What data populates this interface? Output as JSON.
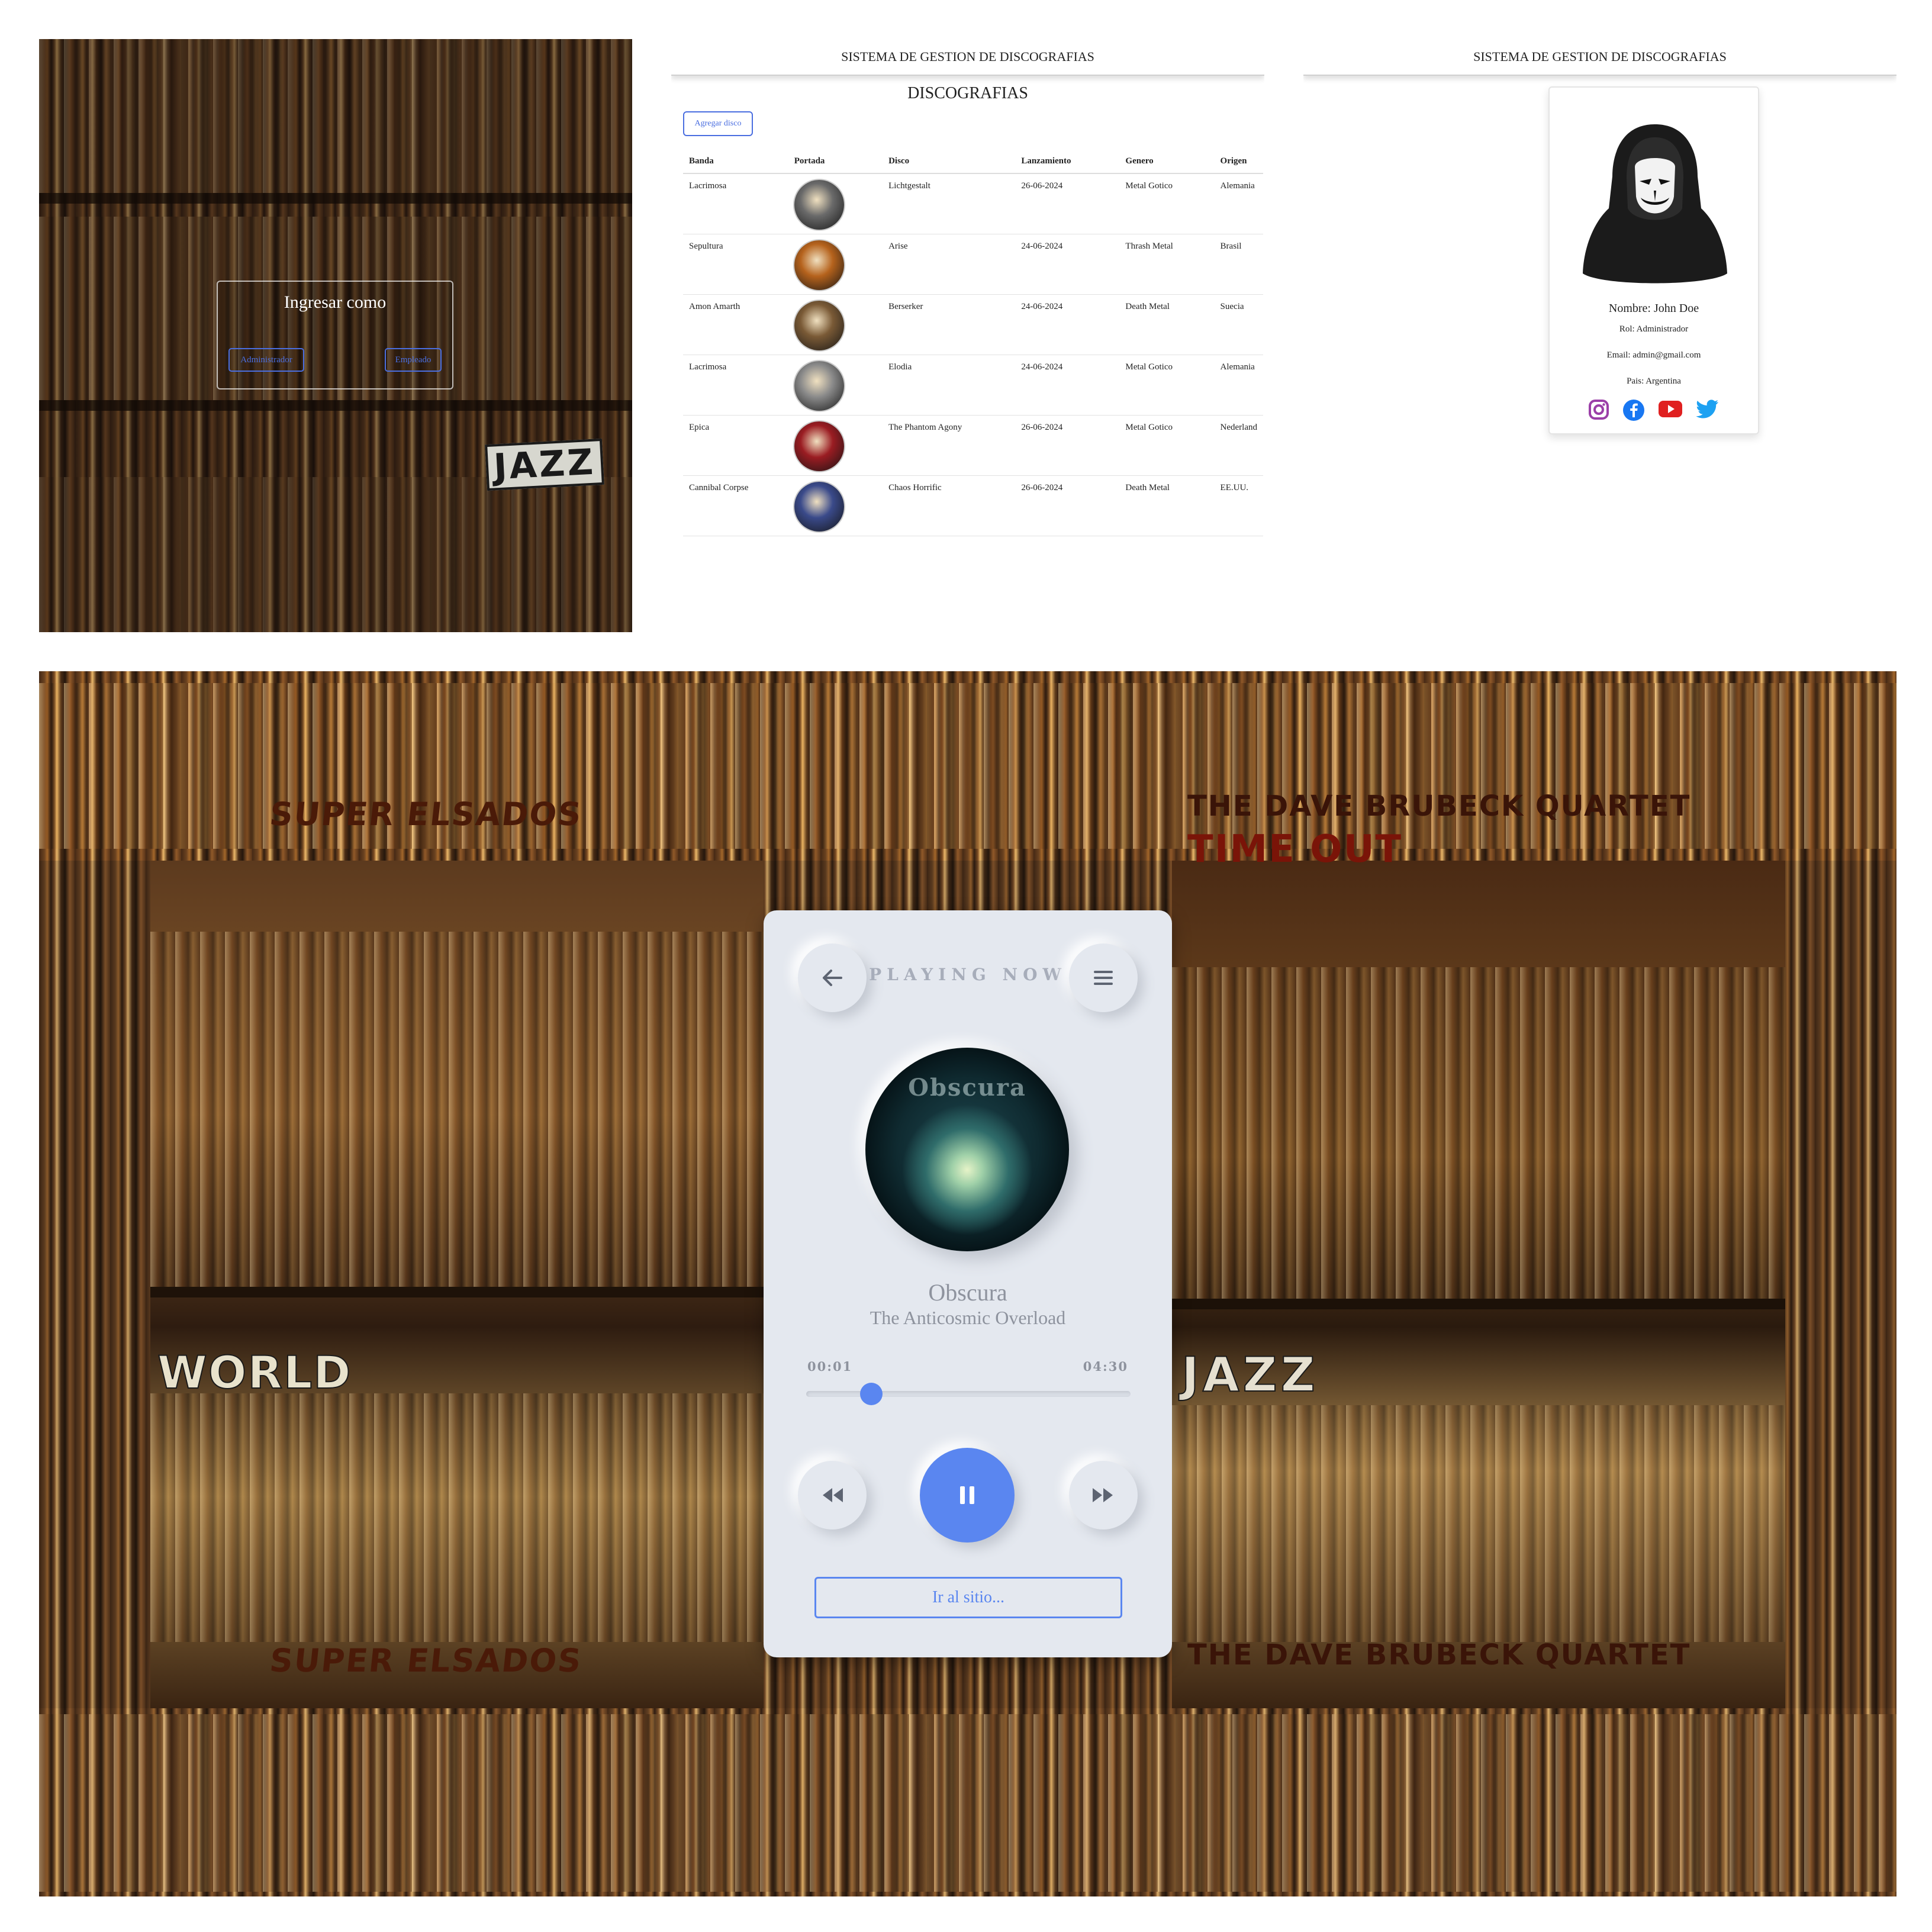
{
  "login": {
    "title": "Ingresar como",
    "admin_button": "Administrador",
    "employee_button": "Empleado"
  },
  "header": {
    "site_title": "SISTEMA DE GESTION DE DISCOGRAFIAS"
  },
  "discography": {
    "title": "DISCOGRAFIAS",
    "add_button": "Agregar disco",
    "columns": [
      "Banda",
      "Portada",
      "Disco",
      "Lanzamiento",
      "Genero",
      "Origen"
    ],
    "rows": [
      {
        "band": "Lacrimosa",
        "album": "Lichtgestalt",
        "release": "26-06-2024",
        "genre": "Metal Gotico",
        "origin": "Alemania",
        "cover_color": "#6a6a6a"
      },
      {
        "band": "Sepultura",
        "album": "Arise",
        "release": "24-06-2024",
        "genre": "Thrash Metal",
        "origin": "Brasil",
        "cover_color": "#b5621c"
      },
      {
        "band": "Amon Amarth",
        "album": "Berserker",
        "release": "24-06-2024",
        "genre": "Death Metal",
        "origin": "Suecia",
        "cover_color": "#7a5a36"
      },
      {
        "band": "Lacrimosa",
        "album": "Elodia",
        "release": "24-06-2024",
        "genre": "Metal Gotico",
        "origin": "Alemania",
        "cover_color": "#8a8a8a"
      },
      {
        "band": "Epica",
        "album": "The Phantom Agony",
        "release": "26-06-2024",
        "genre": "Metal Gotico",
        "origin": "Nederland",
        "cover_color": "#9a1c22"
      },
      {
        "band": "Cannibal Corpse",
        "album": "Chaos Horrific",
        "release": "26-06-2024",
        "genre": "Death Metal",
        "origin": "EE.UU.",
        "cover_color": "#3a4a8a"
      }
    ]
  },
  "profile": {
    "name": "Nombre: John Doe",
    "role": "Rol: Administrador",
    "email": "Email: admin@gmail.com",
    "country": "Pais: Argentina",
    "social_icons": [
      "instagram-icon",
      "facebook-icon",
      "youtube-icon",
      "twitter-icon"
    ],
    "colors": {
      "instagram": "#9b3fa8",
      "facebook": "#1877f2",
      "youtube": "#e02020",
      "twitter": "#1da1f2"
    }
  },
  "store_signs": {
    "jazz": "JAZZ",
    "elsados": "SUPER ELSADOS",
    "brubeck": "THE DAVE BRUBECK QUARTET",
    "time_out": "TIME OUT",
    "world": "WORLD"
  },
  "player": {
    "label": "PLAYING NOW",
    "track_title": "Obscura",
    "track_artist": "The Anticosmic Overload",
    "album_glyph": "Obscura",
    "time_current": "00:01",
    "time_total": "04:30",
    "progress": 0.2,
    "site_button": "Ir al sitio...",
    "accent": "#5a86f0"
  }
}
